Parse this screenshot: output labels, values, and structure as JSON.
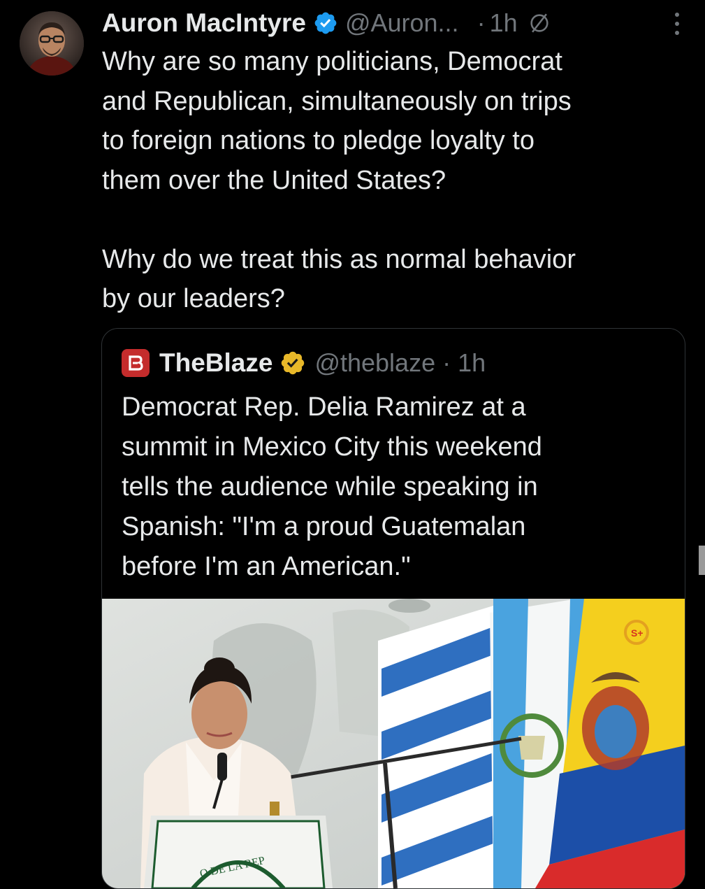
{
  "tweet": {
    "author_name": "Auron MacIntyre",
    "author_handle": "@Auron...",
    "separator": "·",
    "time": "1h",
    "text": "Why are so many politicians, Democrat\nand Republican, simultaneously on trips\nto foreign nations to pledge loyalty to\nthem over the United States?\n\nWhy do we treat this as normal behavior\nby our leaders?"
  },
  "quoted": {
    "author_name": "TheBlaze",
    "handle_time": "@theblaze · 1h",
    "text": "Democrat Rep. Delia Ramirez at a\nsummit in Mexico City this weekend\ntells the audience while speaking in\nSpanish: \"I'm a proud Guatemalan\nbefore I'm an American.\"",
    "media": {
      "podium_text": "O DE LA REP",
      "watermark": "S+"
    }
  },
  "colors": {
    "background": "#000000",
    "text_primary": "#e7e9ea",
    "text_secondary": "#71767b",
    "verified_blue": "#1d9bf0",
    "verified_gold": "#e8b829",
    "blaze_red": "#c42c2c",
    "border": "#2f3336"
  },
  "icons": {
    "verified_badge": "verified-blue-badge-icon",
    "quoted_verified_badge": "verified-gold-badge-icon",
    "muted": "circle-slash-icon",
    "more": "more-vertical-icon",
    "blaze_logo": "theblaze-logo-icon"
  }
}
